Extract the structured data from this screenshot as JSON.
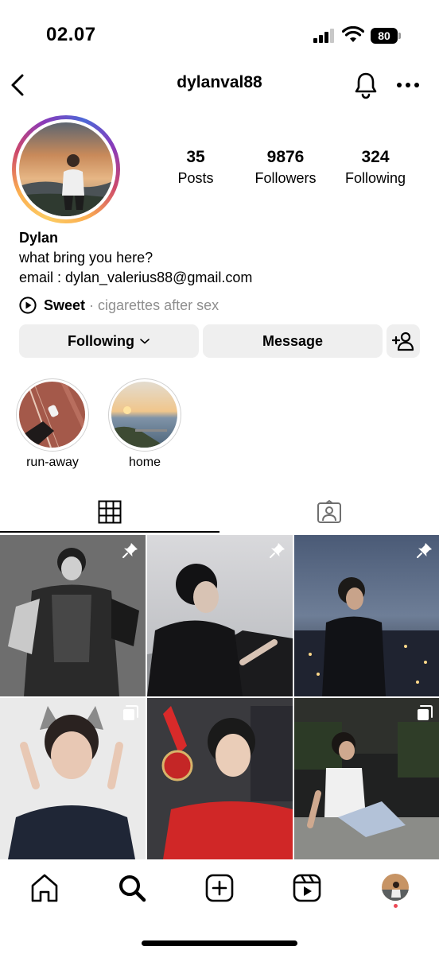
{
  "status_bar": {
    "time": "02.07",
    "battery": "80"
  },
  "header": {
    "username": "dylanval88",
    "back_icon": "chevron-left-icon",
    "bell_icon": "bell-icon",
    "more_icon": "more-horizontal-icon"
  },
  "profile": {
    "stats": [
      {
        "value": "35",
        "label": "Posts"
      },
      {
        "value": "9876",
        "label": "Followers"
      },
      {
        "value": "324",
        "label": "Following"
      }
    ],
    "name": "Dylan",
    "bio_line1": "what bring you here?",
    "bio_line2": "email : dylan_valerius88@gmail.com",
    "music": {
      "title": "Sweet",
      "separator": "·",
      "artist": "cigarettes after sex"
    }
  },
  "actions": {
    "following_label": "Following",
    "message_label": "Message"
  },
  "highlights": [
    {
      "label": "run-away"
    },
    {
      "label": "home"
    }
  ],
  "tabs": [
    {
      "icon": "grid-icon",
      "active": true
    },
    {
      "icon": "tagged-icon",
      "active": false
    }
  ],
  "posts": [
    {
      "badge": "pin-icon"
    },
    {
      "badge": "pin-icon"
    },
    {
      "badge": "pin-icon"
    },
    {
      "badge": "carousel-icon"
    },
    {
      "badge": "none"
    },
    {
      "badge": "carousel-icon"
    }
  ],
  "bottom_nav": [
    "home-icon",
    "search-icon",
    "create-icon",
    "reels-icon",
    "profile-avatar"
  ],
  "colors": {
    "button_bg": "#efefef",
    "secondary_text": "#8e8e8e",
    "notification_dot": "#ed4956"
  }
}
